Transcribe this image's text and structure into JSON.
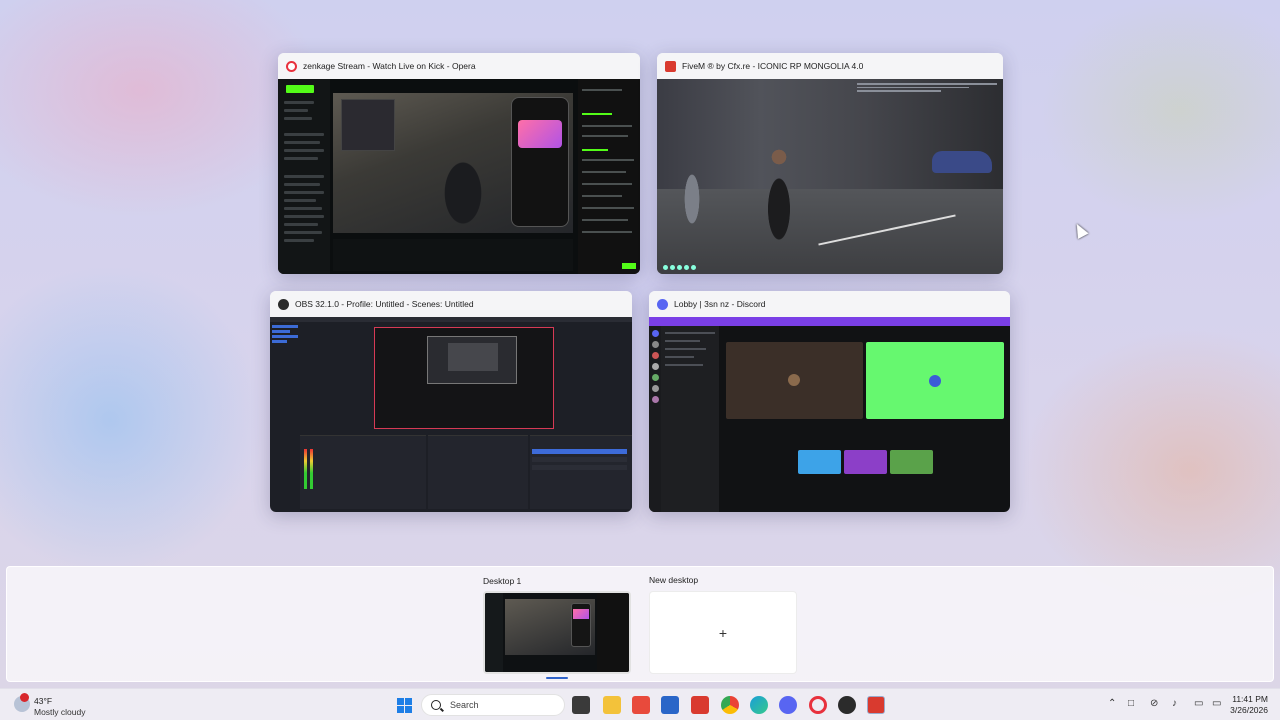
{
  "windows": [
    {
      "title": "zenkage Stream - Watch Live on Kick - Opera",
      "app": "opera-icon",
      "icon_color": "#e8313d"
    },
    {
      "title": "FiveM ® by Cfx.re - ICONIC RP MONGOLIA 4.0",
      "app": "fivem-icon",
      "icon_color": "#d93a2f"
    },
    {
      "title": "OBS 32.1.0 - Profile: Untitled - Scenes: Untitled",
      "app": "obs-icon",
      "icon_color": "#2b2b2b"
    },
    {
      "title": "Lobby | 3sn nz - Discord",
      "app": "discord-icon",
      "icon_color": "#5865f2"
    }
  ],
  "kick": {
    "logo": "KICK"
  },
  "desktops": {
    "items": [
      {
        "label": "Desktop 1",
        "selected": true
      },
      {
        "label": "New desktop",
        "add_glyph": "+"
      }
    ]
  },
  "taskbar": {
    "weather": {
      "temp": "43°F",
      "condition": "Mostly cloudy"
    },
    "search_label": "Search",
    "pinned": [
      "windows-start-icon",
      "search-icon",
      "task-view-icon",
      "file-explorer-icon",
      "wps-icon",
      "calculator-icon",
      "fivem-icon",
      "chrome-icon",
      "edge-icon",
      "discord-icon",
      "opera-icon",
      "obs-icon",
      "fivem-running-icon"
    ],
    "tray": [
      "chevron-up-icon",
      "network-icon",
      "wifi-off-icon",
      "volume-icon",
      "battery-icon"
    ],
    "time": "11:41 PM",
    "date": "3/26/2026"
  },
  "colors": {
    "kick_green": "#53fc18",
    "discord_blurple": "#5865f2",
    "taskbar_bg": "#eeecf4"
  }
}
